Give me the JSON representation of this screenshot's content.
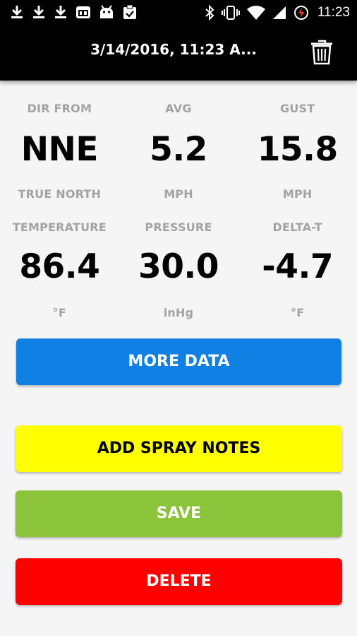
{
  "status_bar": {
    "time": "11:23",
    "left_icons": [
      "download-icon",
      "download-icon",
      "download-icon",
      "calendar-icon",
      "android-icon",
      "clipboard-icon"
    ],
    "right_icons": [
      "bluetooth-icon",
      "vibrate-icon",
      "wifi-icon",
      "signal-icon",
      "battery-charging-icon"
    ]
  },
  "toolbar": {
    "title": "3/14/2016, 11:23 A...",
    "trash_icon": "trash-icon"
  },
  "wind": {
    "dir_from": {
      "label": "DIR FROM",
      "value": "NNE",
      "unit": "TRUE NORTH"
    },
    "avg": {
      "label": "AVG",
      "value": "5.2",
      "unit": "MPH"
    },
    "gust": {
      "label": "GUST",
      "value": "15.8",
      "unit": "MPH"
    }
  },
  "conditions": {
    "temperature": {
      "label": "TEMPERATURE",
      "value": "86.4",
      "unit": "°F"
    },
    "pressure": {
      "label": "PRESSURE",
      "value": "30.0",
      "unit": "inHg"
    },
    "delta_t": {
      "label": "DELTA-T",
      "value": "-4.7",
      "unit": "°F"
    }
  },
  "buttons": {
    "more_data": "MORE DATA",
    "add_spray_notes": "ADD SPRAY NOTES",
    "save": "SAVE",
    "delete": "DELETE"
  },
  "colors": {
    "more_data": "#1080e4",
    "add_spray_notes": "#ffff00",
    "save": "#8bc33a",
    "delete": "#ff0000",
    "label_gray": "#a3a3a3"
  }
}
